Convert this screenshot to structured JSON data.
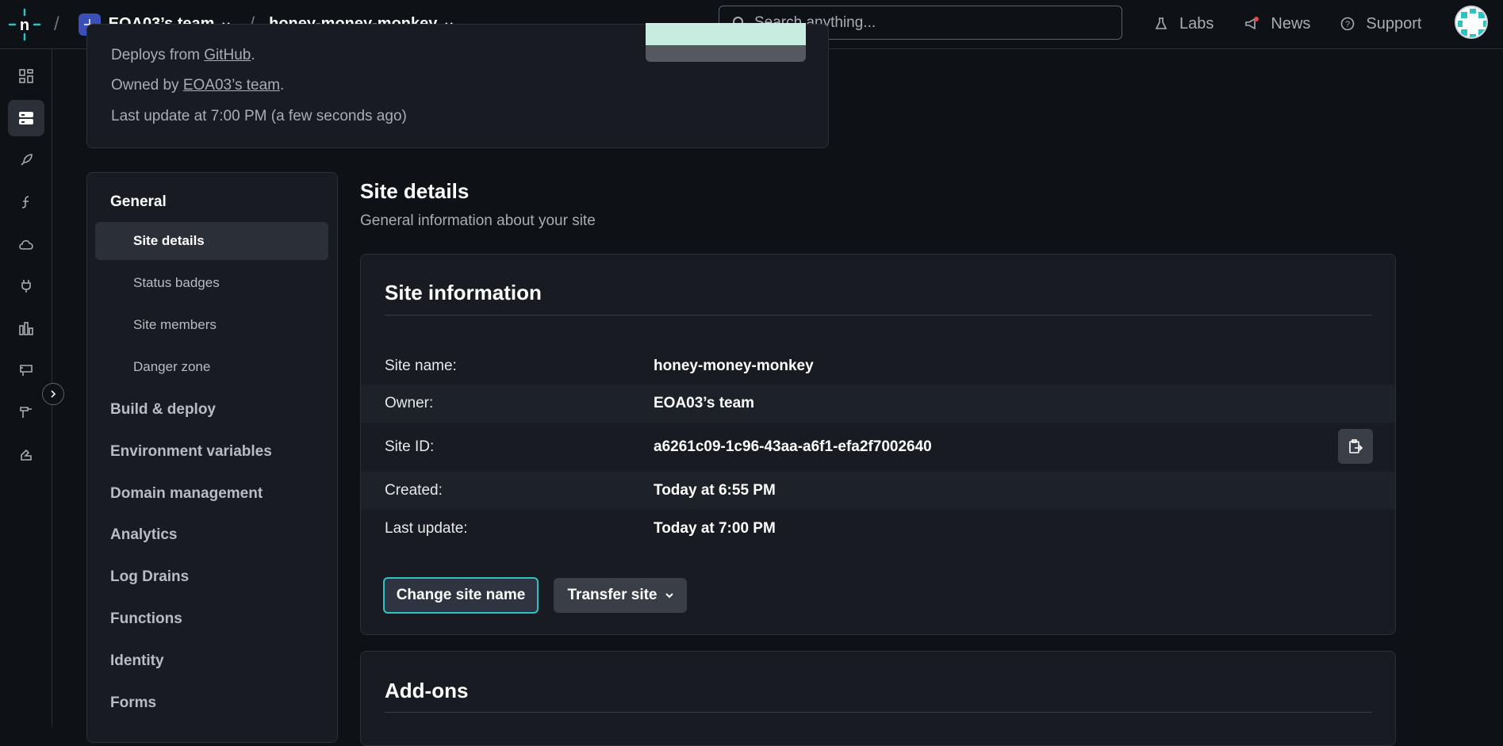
{
  "topbar": {
    "team": "EOA03’s team",
    "site": "honey-money-monkey",
    "search_placeholder": "Search anything...",
    "nav": {
      "labs": "Labs",
      "news": "News",
      "support": "Support"
    }
  },
  "overview": {
    "deploys_prefix": "Deploys from ",
    "deploys_link": "GitHub",
    "deploys_suffix": ".",
    "owned_prefix": "Owned by ",
    "owned_link": "EOA03’s team",
    "owned_suffix": ".",
    "last_update": "Last update at 7:00 PM (a few seconds ago)"
  },
  "sidebar": {
    "section": "General",
    "sub_items": [
      "Site details",
      "Status badges",
      "Site members",
      "Danger zone"
    ],
    "nav_items": [
      "Build & deploy",
      "Environment variables",
      "Domain management",
      "Analytics",
      "Log Drains",
      "Functions",
      "Identity",
      "Forms"
    ]
  },
  "main": {
    "title": "Site details",
    "subtitle": "General information about your site",
    "info_title": "Site information",
    "rows": [
      {
        "label": "Site name:",
        "value": "honey-money-monkey"
      },
      {
        "label": "Owner:",
        "value": "EOA03’s team"
      },
      {
        "label": "Site ID:",
        "value": "a6261c09-1c96-43aa-a6f1-efa2f7002640"
      },
      {
        "label": "Created:",
        "value": "Today at 6:55 PM"
      },
      {
        "label": "Last update:",
        "value": "Today at 7:00 PM"
      }
    ],
    "change_name_label": "Change site name",
    "transfer_label": "Transfer site",
    "addons_title": "Add-ons"
  },
  "colors": {
    "accent": "#2ec2c2",
    "news_dot": "#e5484d",
    "team_badge": "#3b4fb8"
  }
}
